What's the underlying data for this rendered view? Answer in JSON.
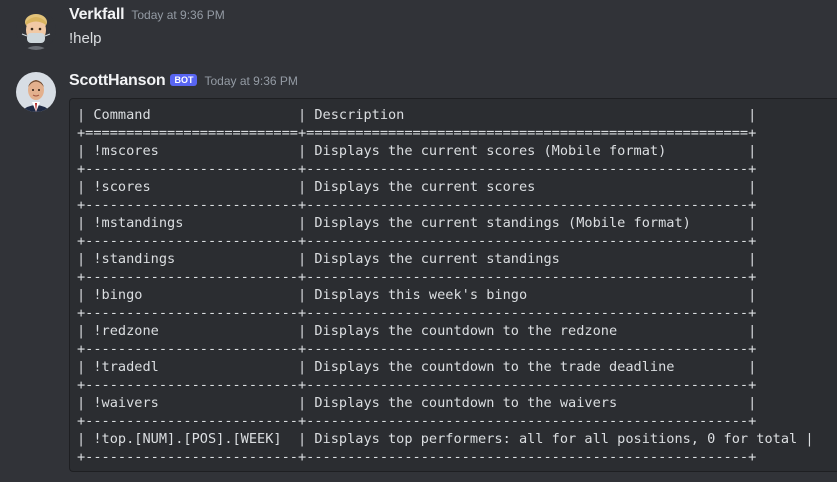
{
  "messages": [
    {
      "username": "Verkfall",
      "timestamp": "Today at 9:36 PM",
      "text": "!help",
      "avatar_icon": "memoji-avatar-icon"
    },
    {
      "username": "ScottHanson",
      "badge": "BOT",
      "timestamp": "Today at 9:36 PM",
      "avatar_icon": "person-photo-avatar-icon",
      "code_lines": [
        "| Command                  | Description                                          |",
        "+==========================+======================================================+",
        "| !mscores                 | Displays the current scores (Mobile format)          |",
        "+--------------------------+------------------------------------------------------+",
        "| !scores                  | Displays the current scores                          |",
        "+--------------------------+------------------------------------------------------+",
        "| !mstandings              | Displays the current standings (Mobile format)       |",
        "+--------------------------+------------------------------------------------------+",
        "| !standings               | Displays the current standings                       |",
        "+--------------------------+------------------------------------------------------+",
        "| !bingo                   | Displays this week's bingo                           |",
        "+--------------------------+------------------------------------------------------+",
        "| !redzone                 | Displays the countdown to the redzone                |",
        "+--------------------------+------------------------------------------------------+",
        "| !tradedl                 | Displays the countdown to the trade deadline         |",
        "+--------------------------+------------------------------------------------------+",
        "| !waivers                 | Displays the countdown to the waivers                |",
        "+--------------------------+------------------------------------------------------+",
        "| !top.[NUM].[POS].[WEEK]  | Displays top performers: all for all positions, 0 for total |",
        "+--------------------------+------------------------------------------------------+"
      ]
    }
  ],
  "colors": {
    "background": "#313338",
    "code_background": "#2b2d31",
    "badge": "#5865f2",
    "username": "#f2f3f5",
    "timestamp": "#949ba4",
    "text": "#dbdee1"
  }
}
